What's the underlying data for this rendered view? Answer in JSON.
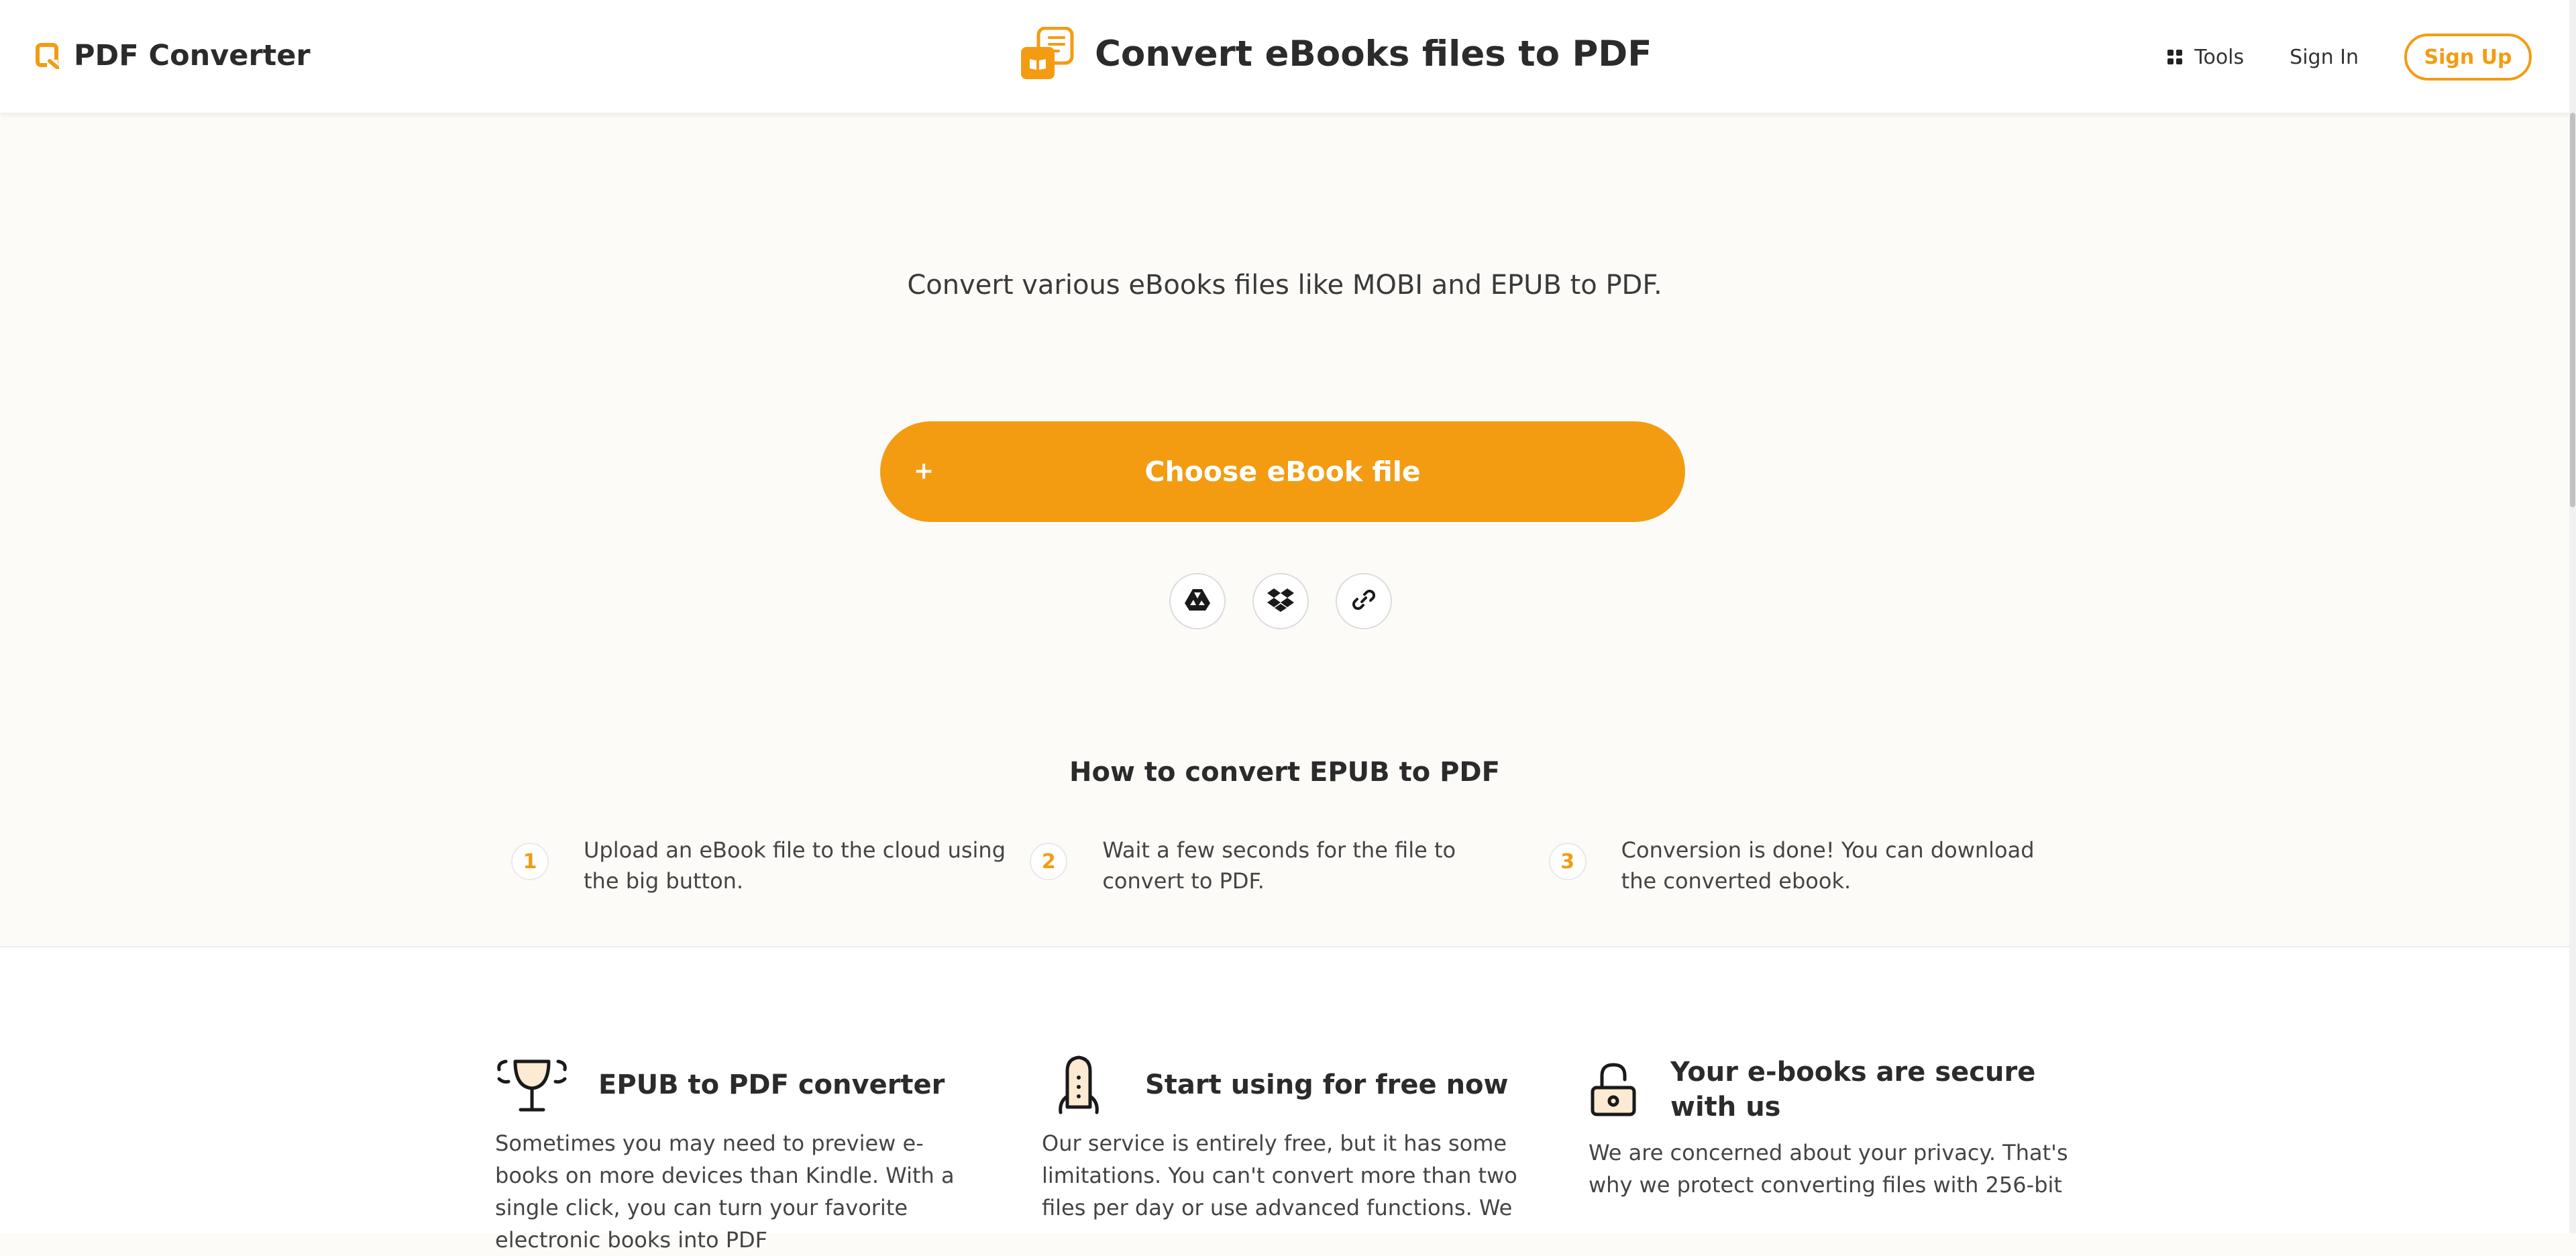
{
  "header": {
    "brand": "PDF Converter",
    "page_title": "Convert eBooks files to PDF",
    "nav": {
      "tools": "Tools",
      "sign_in": "Sign In",
      "sign_up": "Sign Up"
    }
  },
  "hero": {
    "subtitle": "Convert various eBooks files like MOBI and EPUB to PDF.",
    "choose_button": {
      "icon": "+",
      "label": "Choose eBook file"
    },
    "sources": [
      "google-drive-icon",
      "dropbox-icon",
      "link-icon"
    ]
  },
  "how_to": {
    "title": "How to convert EPUB to PDF",
    "steps": [
      {
        "num": "1",
        "text": "Upload an eBook file to the cloud using the big button."
      },
      {
        "num": "2",
        "text": "Wait a few seconds for the file to convert to PDF."
      },
      {
        "num": "3",
        "text": "Conversion is done! You can download the converted ebook."
      }
    ]
  },
  "features": [
    {
      "icon": "trophy-icon",
      "title": "EPUB to PDF converter",
      "body": "Sometimes you may need to preview e-books on more devices than Kindle. With a single click, you can turn your favorite electronic books into PDF"
    },
    {
      "icon": "rocket-icon",
      "title": "Start using for free now",
      "body": "Our service is entirely free, but it has some limitations. You can't convert more than two files per day or use advanced functions. We"
    },
    {
      "icon": "lock-icon",
      "title": "Your e-books are secure with us",
      "body": "We are concerned about your privacy. That's why we protect converting files with 256-bit"
    }
  ],
  "colors": {
    "accent": "#f39c12",
    "background": "#fcfbf8"
  }
}
